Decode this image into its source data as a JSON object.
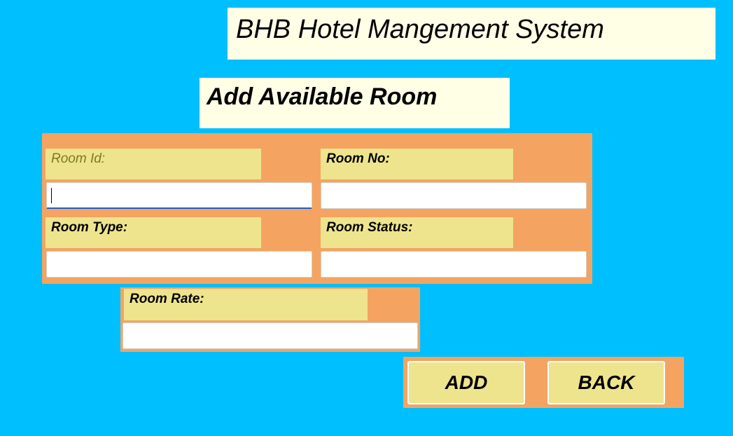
{
  "header": {
    "title": "BHB Hotel Mangement System",
    "subtitle": "Add Available Room"
  },
  "form": {
    "room_id_label": "Room Id:",
    "room_no_label": "Room No:",
    "room_type_label": "Room Type:",
    "room_status_label": "Room Status:",
    "room_rate_label": "Room Rate:",
    "room_id_value": "",
    "room_no_value": "",
    "room_type_value": "",
    "room_status_value": "",
    "room_rate_value": ""
  },
  "actions": {
    "add_label": "ADD",
    "back_label": "BACK"
  },
  "colors": {
    "background": "#00BFFF",
    "panel": "#F4A460",
    "label_bg": "#EEE48E",
    "title_bg": "#FFFFE6"
  }
}
